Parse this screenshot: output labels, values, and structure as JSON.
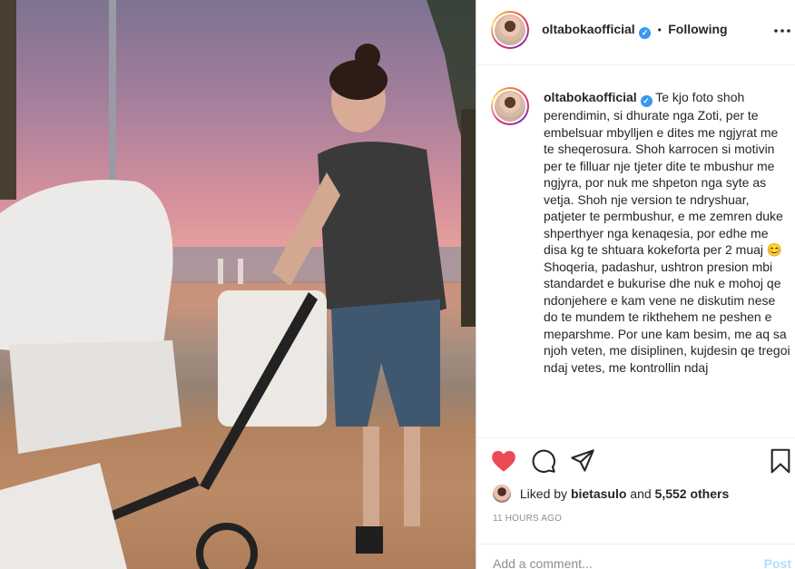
{
  "post": {
    "username": "oltabokaofficial",
    "verified_glyph": "✓",
    "header_separator": "•",
    "follow_status": "Following",
    "more_icon": "more-horizontal-icon",
    "caption_username": "oltabokaofficial",
    "caption": "Te kjo foto shoh perendimin, si dhurate nga Zoti, per te embelsuar mbylljen e dites me ngjyrat me te sheqerosura. Shoh karrocen si motivin per te filluar nje tjeter dite te mbushur me ngjyra, por nuk me shpeton nga syte as vetja. Shoh nje version te ndryshuar, patjeter te permbushur, e me zemren duke shperthyer nga kenaqesia, por edhe me disa kg te shtuara kokeforta per 2 muaj 😊",
    "caption_more": "Shoqeria, padashur, ushtron presion mbi standardet e bukurise dhe nuk e mohoj qe ndonjehere e kam vene ne diskutim nese do te mundem te rikthehem ne peshen e meparshme. Por une kam besim, me aq sa njoh veten, me disiplinen, kujdesin qe tregoi ndaj vetes, me kontrollin ndaj",
    "likes_prefix": "Liked by",
    "liked_by_user": "bietasulo",
    "likes_and": "and",
    "likes_count": "5,552 others",
    "timestamp": "11 HOURS AGO",
    "comment_placeholder": "Add a comment...",
    "post_label": "Post"
  },
  "icons": {
    "like": "heart-filled-icon",
    "comment": "comment-icon",
    "share": "share-icon",
    "save": "bookmark-icon"
  },
  "colors": {
    "like_red": "#ed4956",
    "verified_blue": "#3897f0",
    "post_button_disabled": "#b2dffc",
    "muted_text": "#8e8e8e"
  }
}
